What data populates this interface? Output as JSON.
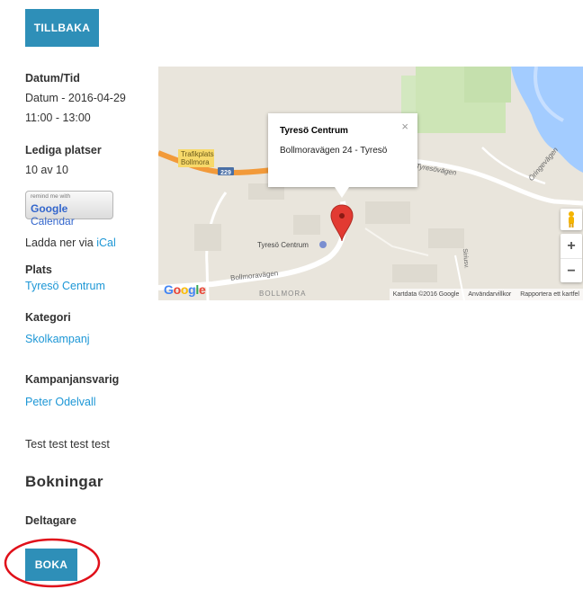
{
  "buttons": {
    "back": "TILLBAKA",
    "book": "BOKA"
  },
  "event": {
    "datetime_label": "Datum/Tid",
    "date_line": "Datum - 2016-04-29",
    "time_line": "11:00 - 13:00",
    "seats_label": "Lediga platser",
    "seats_value": "10 av 10",
    "gcal_small": "remind me with",
    "gcal_google": "Google",
    "gcal_calendar": "Calendar",
    "ical_prefix": "Ladda ner via ",
    "ical_link": "iCal",
    "place_label": "Plats",
    "place_link": "Tyresö Centrum",
    "category_label": "Kategori",
    "category_link": "Skolkampanj",
    "responsible_label": "Kampanjansvarig",
    "responsible_link": "Peter Odelvall",
    "description": "Test test test test",
    "bookings_heading": "Bokningar",
    "participants_label": "Deltagare"
  },
  "map": {
    "info_title": "Tyresö Centrum",
    "info_address": "Bollmoravägen 24 - Tyresö",
    "info_close": "×",
    "labels": {
      "trafikplats": "Trafikplats",
      "bollmora": "Bollmora",
      "road_number": "229",
      "tyresovagen": "Tyresövägen",
      "oringevagen": "Öringevägen",
      "centrum": "Tyresö Centrum",
      "bollmoravagen": "Bollmoravägen",
      "bollmora_area": "BOLLMORA",
      "siriusvagen": "Siriusv."
    },
    "attribution": {
      "data": "Kartdata ©2016 Google",
      "terms": "Användarvillkor",
      "report": "Rapportera ett kartfel"
    },
    "zoom_in": "+",
    "zoom_out": "−",
    "logo": [
      "G",
      "o",
      "o",
      "g",
      "l",
      "e"
    ]
  },
  "colors": {
    "button": "#2e8fb8",
    "link": "#1d97d6",
    "highlight_circle": "#e0101a",
    "pin": "#e23a32",
    "water": "#a3ccff",
    "highway": "#f29a3a"
  }
}
